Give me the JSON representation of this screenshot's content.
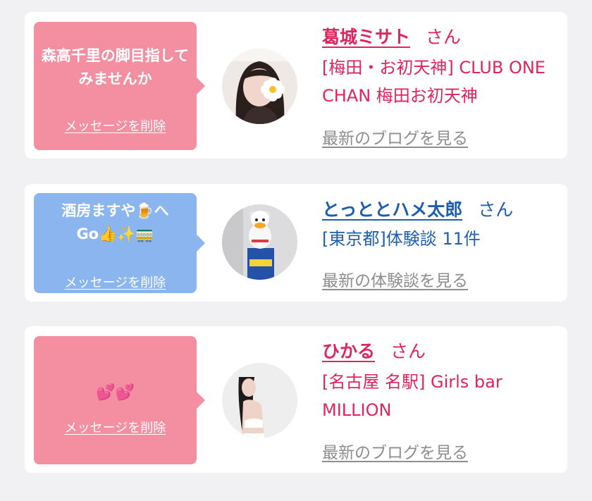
{
  "items": [
    {
      "message": "森高千里の脚目指してみませんか",
      "message_emoji": "",
      "delete_label": "メッセージを削除",
      "name": "葛城ミサト",
      "honorific": "さん",
      "info": "[梅田・お初天神] CLUB ONE CHAN 梅田お初天神",
      "link": "最新のブログを見る",
      "bubble_color": "#f48fa1",
      "text_color": "#e0245e"
    },
    {
      "message": "酒房ますや🍺へGo👍✨🚃",
      "message_emoji": "",
      "delete_label": "メッセージを削除",
      "name": "とっととハメ太郎",
      "honorific": "さん",
      "info": "[東京都]体験談 11件",
      "link": "最新の体験談を見る",
      "bubble_color": "#8bb5ee",
      "text_color": "#1d5fae"
    },
    {
      "message": "",
      "message_emoji": "💕💕",
      "delete_label": "メッセージを削除",
      "name": "ひかる",
      "honorific": "さん",
      "info": "[名古屋 名駅] Girls bar MILLION",
      "link": "最新のブログを見る",
      "bubble_color": "#f48fa1",
      "text_color": "#e0245e"
    }
  ]
}
